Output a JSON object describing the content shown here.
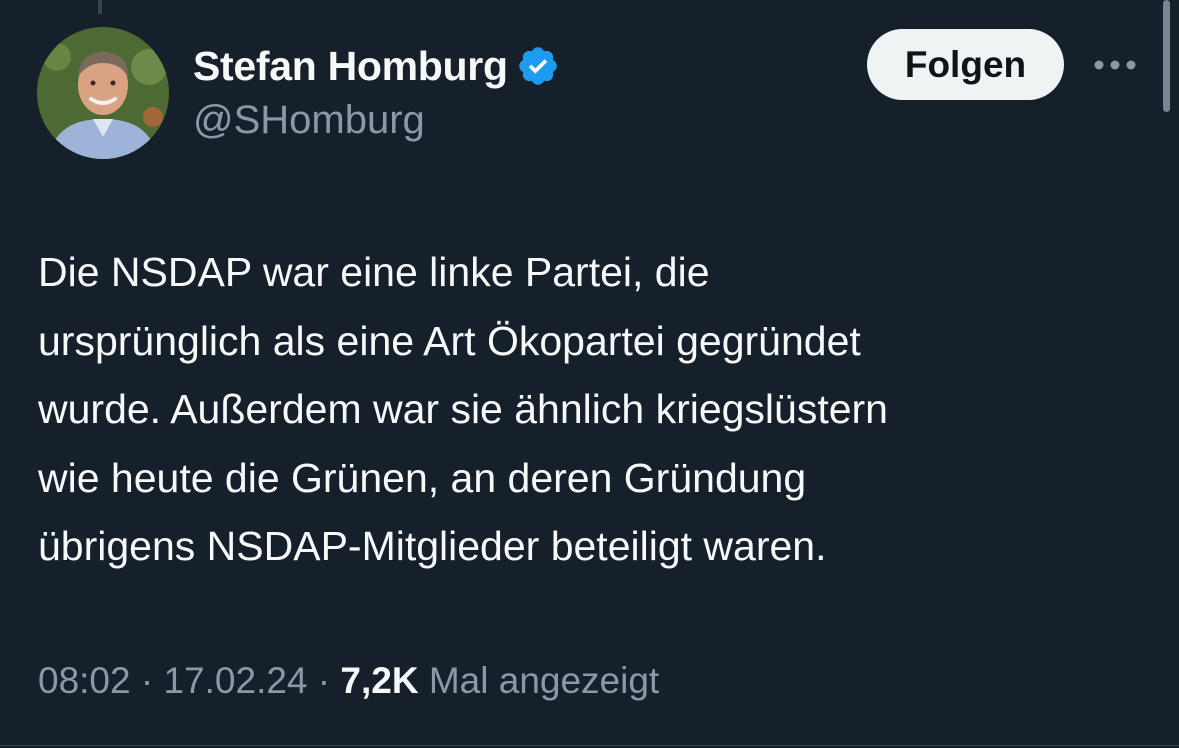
{
  "author": {
    "display_name": "Stefan Homburg",
    "handle": "@SHomburg",
    "verified_icon": "verified-badge-icon",
    "badge_color": "#1d9bf0"
  },
  "actions": {
    "follow_label": "Folgen",
    "more_icon": "more-horizontal-icon"
  },
  "tweet": {
    "text": "Die NSDAP war eine linke Partei, die\nursprünglich als eine Art Ökopartei gegründet\nwurde. Außerdem war sie ähnlich kriegslüstern\nwie heute die Grünen, an deren Gründung\nübrigens NSDAP-Mitglieder beteiligt waren."
  },
  "meta": {
    "time": "08:02",
    "separator": " · ",
    "date": "17.02.24",
    "views_count": "7,2K",
    "views_label": " Mal angezeigt"
  },
  "theme": {
    "background": "#15202b",
    "text": "#f7f9f9",
    "secondary_text": "#8b98a5"
  }
}
